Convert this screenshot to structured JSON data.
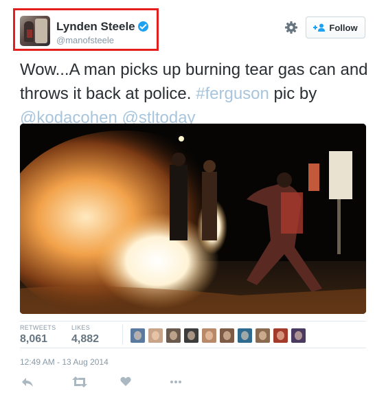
{
  "user": {
    "display_name": "Lynden Steele",
    "screen_name": "@manofsteele",
    "verified_icon": "verified-badge-icon"
  },
  "header": {
    "settings_icon": "gear-icon",
    "follow_label": "Follow",
    "follow_icon": "add-user-icon"
  },
  "tweet": {
    "text_1": "Wow...A man picks up burning tear gas can and throws it back at police. ",
    "hashtag": "#ferguson",
    "text_2": " pic by ",
    "mention_1": "@kodacohen",
    "mention_2": "@stltoday",
    "link_color": "#a8c5dd"
  },
  "stats": {
    "retweets_label": "RETWEETS",
    "retweets_value": "8,061",
    "likes_label": "LIKES",
    "likes_value": "4,882"
  },
  "likers": [
    {
      "color": "#5a7aa0"
    },
    {
      "color": "#c7a48a"
    },
    {
      "color": "#6a5a4e"
    },
    {
      "color": "#3c3c3c"
    },
    {
      "color": "#b98a6a"
    },
    {
      "color": "#7d5b46"
    },
    {
      "color": "#2f6a8f"
    },
    {
      "color": "#8a6a50"
    },
    {
      "color": "#a33a2a"
    },
    {
      "color": "#4a3a60"
    }
  ],
  "timestamp": "12:49 AM - 13 Aug 2014",
  "actions": {
    "reply_icon": "reply-icon",
    "retweet_icon": "retweet-icon",
    "like_icon": "heart-icon",
    "more_icon": "more-dots-icon"
  },
  "colors": {
    "highlight": "#e41d1d",
    "verified": "#1da1f2",
    "muted_text": "#8899a6"
  }
}
